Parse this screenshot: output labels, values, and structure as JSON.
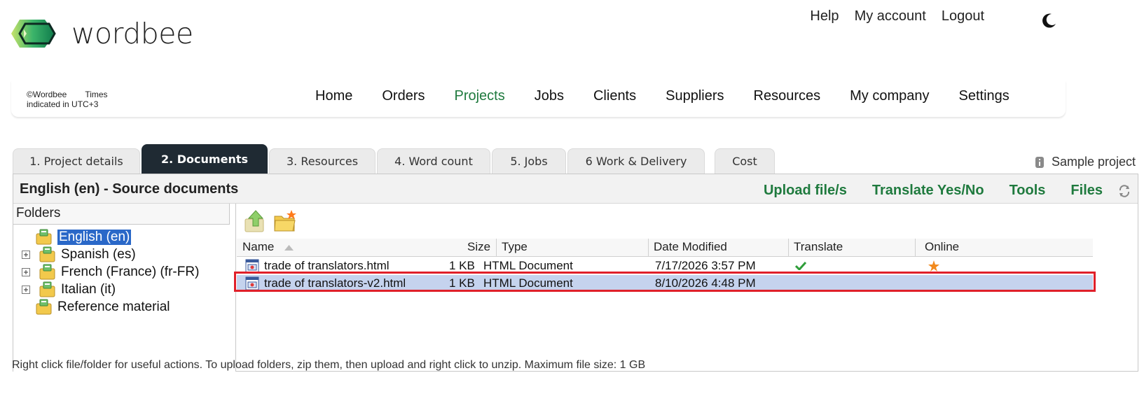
{
  "brand": {
    "name": "wordbee"
  },
  "top_links": {
    "help": "Help",
    "account": "My account",
    "logout": "Logout"
  },
  "info": {
    "copyright": "©Wordbee",
    "times": "Times",
    "utc": "indicated in UTC+3"
  },
  "nav": {
    "home": "Home",
    "orders": "Orders",
    "projects": "Projects",
    "jobs": "Jobs",
    "clients": "Clients",
    "suppliers": "Suppliers",
    "resources": "Resources",
    "my_company": "My company",
    "settings": "Settings"
  },
  "tabs": {
    "project_details": "1. Project details",
    "documents": "2. Documents",
    "resources": "3. Resources",
    "word_count": "4. Word count",
    "jobs": "5. Jobs",
    "work_delivery": "6 Work & Delivery",
    "cost": "Cost"
  },
  "sample_project": "Sample project",
  "panel": {
    "title": "English (en) - Source documents",
    "actions": {
      "upload": "Upload file/s",
      "translate": "Translate Yes/No",
      "tools": "Tools",
      "files": "Files"
    }
  },
  "folders": {
    "header": "Folders",
    "items": [
      "English (en)",
      "Spanish (es)",
      "French (France) (fr-FR)",
      "Italian (it)",
      "Reference material"
    ]
  },
  "columns": {
    "name": "Name",
    "size": "Size",
    "type": "Type",
    "date": "Date Modified",
    "translate": "Translate",
    "online": "Online"
  },
  "files": [
    {
      "name": "trade of translators.html",
      "size": "1 KB",
      "type": "HTML Document",
      "date": "7/17/2026 3:57 PM",
      "translate": true,
      "online": true
    },
    {
      "name": "trade of translators-v2.html",
      "size": "1 KB",
      "type": "HTML Document",
      "date": "8/10/2026 4:48 PM",
      "translate": false,
      "online": false
    }
  ],
  "footer_note": "Right click file/folder for useful actions. To upload folders, zip them, then upload and right click to unzip. Maximum file size: 1 GB",
  "colors": {
    "accent_green": "#1f7a3e",
    "active_tab": "#1f2a33",
    "selection": "#2a68c8",
    "row_selected": "#c5d3ee",
    "highlight": "#e0202a"
  }
}
